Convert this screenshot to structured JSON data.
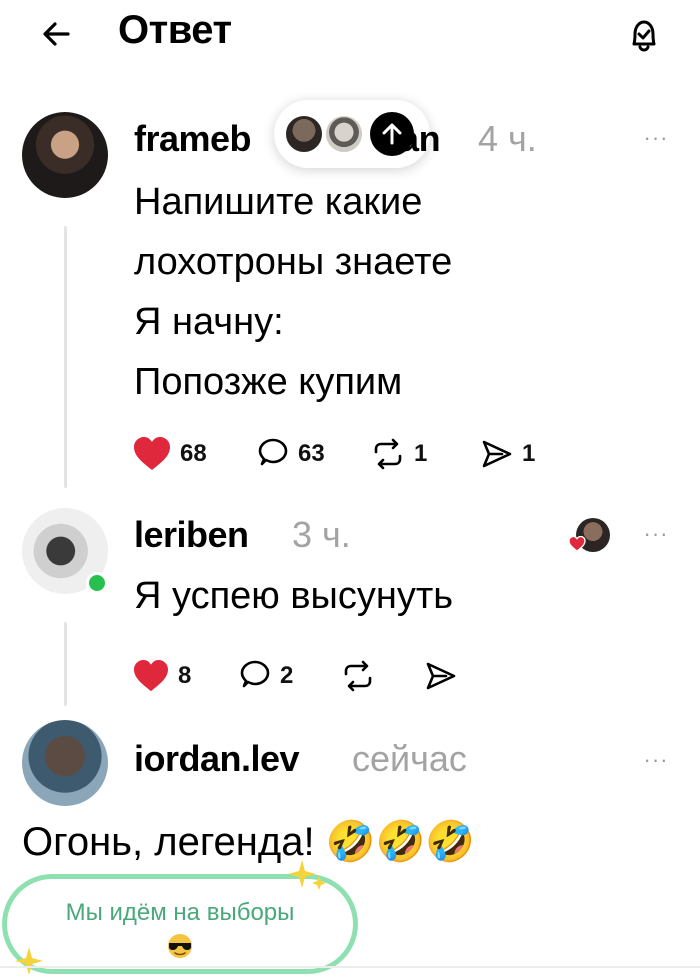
{
  "header": {
    "title": "Ответ",
    "back_icon": "arrow-left-icon",
    "bell_icon": "bell-check-icon"
  },
  "scroll_pill": {
    "icon": "arrow-up-icon"
  },
  "posts": [
    {
      "username_start": "frameb",
      "username_end": "an",
      "time": "4 ч.",
      "lines": [
        "Напишите какие",
        "лохотроны знаете",
        "Я начну:",
        "Попозже купим"
      ],
      "likes": "68",
      "comments": "63",
      "reposts": "1",
      "shares": "1"
    },
    {
      "username": "leriben",
      "time": "3 ч.",
      "text": "Я успею высунуть",
      "likes": "8",
      "comments": "2"
    },
    {
      "username": "iordan.lev",
      "time": "сейчас"
    }
  ],
  "reply": {
    "text": "Огонь, легенда! 🤣🤣🤣"
  },
  "sticker": {
    "text": "Мы идём на выборы",
    "emoji": "😎"
  },
  "colors": {
    "like_red": "#e0283c",
    "online_green": "#27c04f",
    "sticker_green": "#8fe0b0",
    "muted_gray": "#a3a3a3"
  }
}
